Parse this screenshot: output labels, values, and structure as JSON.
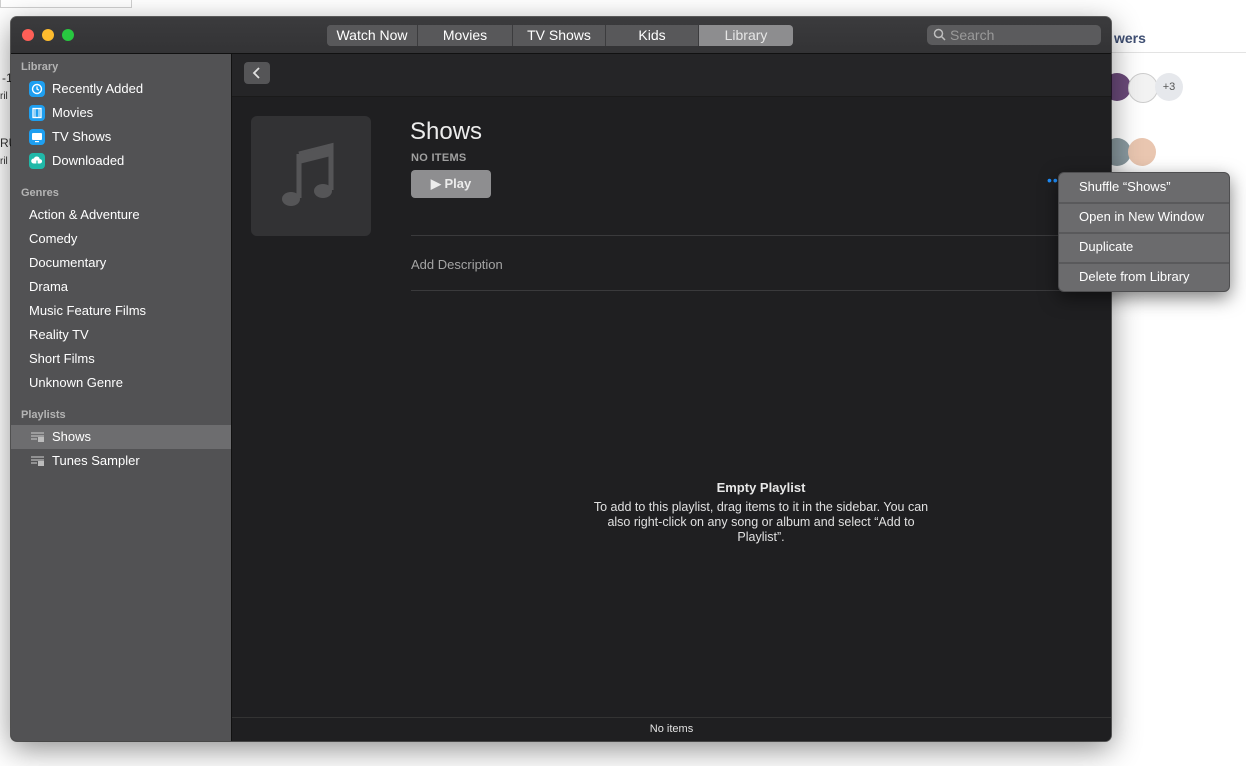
{
  "window": {
    "tabs": [
      {
        "label": "Watch Now",
        "active": false
      },
      {
        "label": "Movies",
        "active": false
      },
      {
        "label": "TV Shows",
        "active": false
      },
      {
        "label": "Kids",
        "active": false
      },
      {
        "label": "Library",
        "active": true
      }
    ],
    "search": {
      "placeholder": "Search"
    }
  },
  "sidebar": {
    "library_heading": "Library",
    "library_items": [
      {
        "label": "Recently Added",
        "icon": "clock-icon"
      },
      {
        "label": "Movies",
        "icon": "film-icon"
      },
      {
        "label": "TV Shows",
        "icon": "tv-icon"
      },
      {
        "label": "Downloaded",
        "icon": "cloud-download-icon"
      }
    ],
    "genres_heading": "Genres",
    "genres": [
      "Action & Adventure",
      "Comedy",
      "Documentary",
      "Drama",
      "Music Feature Films",
      "Reality TV",
      "Short Films",
      "Unknown Genre"
    ],
    "playlists_heading": "Playlists",
    "playlists": [
      {
        "label": "Shows",
        "selected": true
      },
      {
        "label": "Tunes Sampler",
        "selected": false
      }
    ]
  },
  "main": {
    "title": "Shows",
    "count_label": "NO ITEMS",
    "play_label": "Play",
    "add_description": "Add Description",
    "empty_title": "Empty Playlist",
    "empty_text": "To add to this playlist, drag items to it in the sidebar. You can also right-click on any song or album and select “Add to Playlist”.",
    "status": "No items"
  },
  "context_menu": {
    "items": [
      "Shuffle “Shows”",
      "Open in New Window",
      "Duplicate",
      "Delete from Library"
    ]
  },
  "background_page": {
    "header_fragment": "wers",
    "avatar_extra": "+3",
    "left_fragments": [
      "-1",
      "ril",
      "RU",
      "ril"
    ]
  }
}
